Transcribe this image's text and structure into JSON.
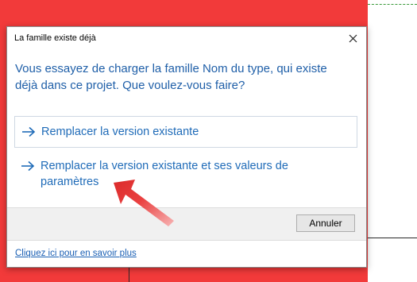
{
  "dialog": {
    "title": "La famille existe déjà",
    "close_icon": "close-icon",
    "question": "Vous essayez de charger la famille Nom du type, qui existe déjà dans ce projet. Que voulez-vous faire?",
    "options": [
      {
        "label": "Remplacer la version existante",
        "icon": "arrow-right-icon"
      },
      {
        "label": "Remplacer la version existante et ses valeurs de paramètres",
        "icon": "arrow-right-icon"
      }
    ],
    "cancel_label": "Annuler",
    "help_link": "Cliquez ici pour en savoir plus"
  },
  "annotation": {
    "icon": "red-pointer-arrow-icon",
    "color": "#e02020"
  },
  "colors": {
    "background_red": "#f23a3a",
    "question_text": "#1f5fa8",
    "option_text": "#1f6bb8",
    "link": "#1a5fb4"
  }
}
